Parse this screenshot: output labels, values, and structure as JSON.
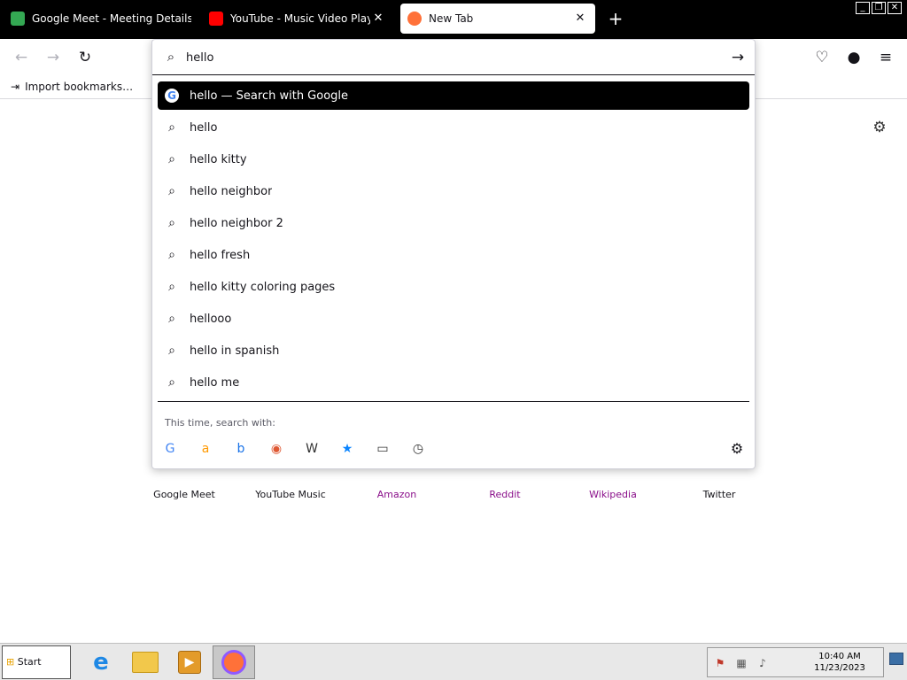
{
  "tabs": [
    {
      "title": "Google Meet - Meeting Details",
      "close": "✕",
      "color": "#34a853"
    },
    {
      "title": "YouTube - Music Video Playlist",
      "close": "✕",
      "color": "#ff0000"
    },
    {
      "title": "New Tab",
      "close": "✕",
      "color": "#ff7139"
    }
  ],
  "new_tab": "+",
  "window_controls": {
    "minimize": "_",
    "restore": "❐",
    "close": "✕"
  },
  "nav": {
    "back": "←",
    "forward": "→",
    "reload": "↻",
    "pocket": "♡",
    "account": "●",
    "menu": "≡"
  },
  "bookmarks": {
    "import_label": "Import bookmarks…"
  },
  "urlbar": {
    "search_icon": "⌕",
    "value": "hello",
    "go": "→",
    "results": [
      {
        "text": "hello — Search with Google",
        "icon": "G"
      },
      {
        "text": "hello",
        "icon": "⌕"
      },
      {
        "text": "hello kitty",
        "icon": "⌕"
      },
      {
        "text": "hello neighbor",
        "icon": "⌕"
      },
      {
        "text": "hello neighbor 2",
        "icon": "⌕"
      },
      {
        "text": "hello fresh",
        "icon": "⌕"
      },
      {
        "text": "hello kitty coloring pages",
        "icon": "⌕"
      },
      {
        "text": "hellooo",
        "icon": "⌕"
      },
      {
        "text": "hello in spanish",
        "icon": "⌕"
      },
      {
        "text": "hello me",
        "icon": "⌕"
      }
    ],
    "oneoff_label": "This time, search with:",
    "engines": [
      {
        "glyph": "G",
        "color": "#4285f4"
      },
      {
        "glyph": "a",
        "color": "#ff9900"
      },
      {
        "glyph": "b",
        "color": "#1a73e8"
      },
      {
        "glyph": "◉",
        "color": "#de5833"
      },
      {
        "glyph": "W",
        "color": "#333333"
      },
      {
        "glyph": "★",
        "color": "#0a84ff"
      },
      {
        "glyph": "▭",
        "color": "#333333"
      },
      {
        "glyph": "◷",
        "color": "#333333"
      }
    ],
    "settings": "⚙"
  },
  "page": {
    "gear": "⚙",
    "shortcuts": [
      {
        "label": "Google Meet"
      },
      {
        "label": "YouTube Music"
      },
      {
        "label": "Amazon"
      },
      {
        "label": "Reddit"
      },
      {
        "label": "Wikipedia"
      },
      {
        "label": "Twitter"
      }
    ]
  },
  "taskbar": {
    "start_label": "Start",
    "clock_time": "10:40 AM",
    "clock_date": "11/23/2023",
    "tray": [
      "⚑",
      "▦",
      "♪"
    ]
  }
}
